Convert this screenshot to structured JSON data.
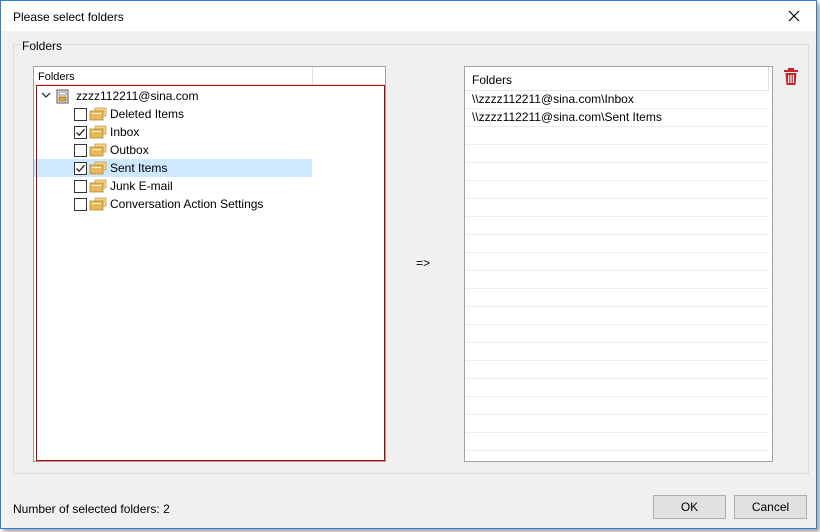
{
  "window": {
    "title": "Please select folders"
  },
  "group": {
    "title": "Folders"
  },
  "tree": {
    "header": "Folders",
    "root": {
      "label": "zzzz112211@sina.com",
      "expanded": true
    },
    "items": [
      {
        "label": "Deleted Items",
        "checked": false,
        "selected": false
      },
      {
        "label": "Inbox",
        "checked": true,
        "selected": false
      },
      {
        "label": "Outbox",
        "checked": false,
        "selected": false
      },
      {
        "label": "Sent Items",
        "checked": true,
        "selected": true
      },
      {
        "label": "Junk E-mail",
        "checked": false,
        "selected": false
      },
      {
        "label": "Conversation Action Settings",
        "checked": false,
        "selected": false
      }
    ]
  },
  "arrow": "=>",
  "list": {
    "header": "Folders",
    "rows": [
      "\\\\zzzz112211@sina.com\\Inbox",
      "\\\\zzzz112211@sina.com\\Sent Items"
    ]
  },
  "status": {
    "text": "Number of selected folders:  2"
  },
  "buttons": {
    "ok": "OK",
    "cancel": "Cancel"
  },
  "colors": {
    "accent": "#2b7fd4",
    "trash": "#c0262c",
    "selection": "#cde8ff",
    "highlight_border": "#c00000",
    "folder": "#e8b85a"
  },
  "icons": {
    "close": "close-icon",
    "trash": "trash-icon",
    "folder": "folder-icon",
    "mailbox": "mailbox-icon",
    "chevron": "chevron-down-icon"
  }
}
